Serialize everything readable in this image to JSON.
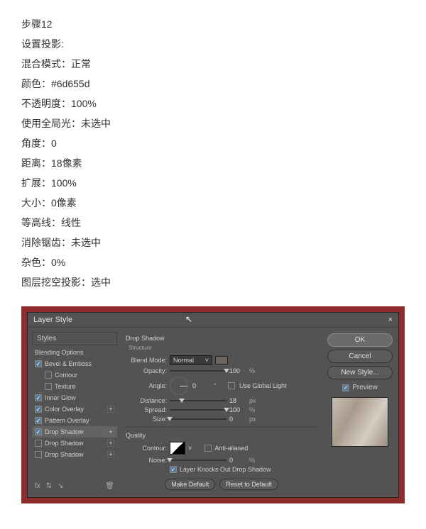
{
  "doc": {
    "step": "步骤12",
    "lines": [
      "设置投影:",
      "混合模式：正常",
      "颜色：#6d655d",
      "不透明度：100%",
      "使用全局光：未选中",
      "角度：0",
      "距离：18像素",
      "扩展：100%",
      "大小：0像素",
      "等高线：线性",
      "消除锯齿：未选中",
      "杂色：0%",
      "图层挖空投影：选中"
    ]
  },
  "dialog": {
    "title": "Layer Style",
    "left_header": "Styles",
    "effects": [
      {
        "label": "Blending Options",
        "checked": null,
        "indent": false,
        "plus": false
      },
      {
        "label": "Bevel & Emboss",
        "checked": true,
        "indent": false,
        "plus": false
      },
      {
        "label": "Contour",
        "checked": false,
        "indent": true,
        "plus": false
      },
      {
        "label": "Texture",
        "checked": false,
        "indent": true,
        "plus": false
      },
      {
        "label": "Inner Glow",
        "checked": true,
        "indent": false,
        "plus": false
      },
      {
        "label": "Color Overlay",
        "checked": true,
        "indent": false,
        "plus": true
      },
      {
        "label": "Pattern Overlay",
        "checked": true,
        "indent": false,
        "plus": false
      },
      {
        "label": "Drop Shadow",
        "checked": true,
        "indent": false,
        "plus": true,
        "selected": true
      },
      {
        "label": "Drop Shadow",
        "checked": false,
        "indent": false,
        "plus": true
      },
      {
        "label": "Drop Shadow",
        "checked": false,
        "indent": false,
        "plus": true
      }
    ],
    "group1": "Drop Shadow",
    "group1sub": "Structure",
    "blend_label": "Blend Mode:",
    "blend_value": "Normal",
    "opacity_label": "Opacity:",
    "opacity_value": "100",
    "pct": "%",
    "angle_label": "Angle:",
    "angle_value": "0",
    "deg": "°",
    "global_label": "Use Global Light",
    "global_checked": false,
    "distance_label": "Distance:",
    "distance_value": "18",
    "px": "px",
    "spread_label": "Spread:",
    "spread_value": "100",
    "size_label": "Size:",
    "size_value": "0",
    "group2": "Quality",
    "contour_label": "Contour:",
    "aa_label": "Anti-aliased",
    "aa_checked": false,
    "noise_label": "Noise:",
    "noise_value": "0",
    "knock_label": "Layer Knocks Out Drop Shadow",
    "knock_checked": true,
    "make_default": "Make Default",
    "reset_default": "Reset to Default",
    "ok": "OK",
    "cancel": "Cancel",
    "new_style": "New Style...",
    "preview_label": "Preview",
    "preview_checked": true,
    "footer_fx": "fx"
  }
}
